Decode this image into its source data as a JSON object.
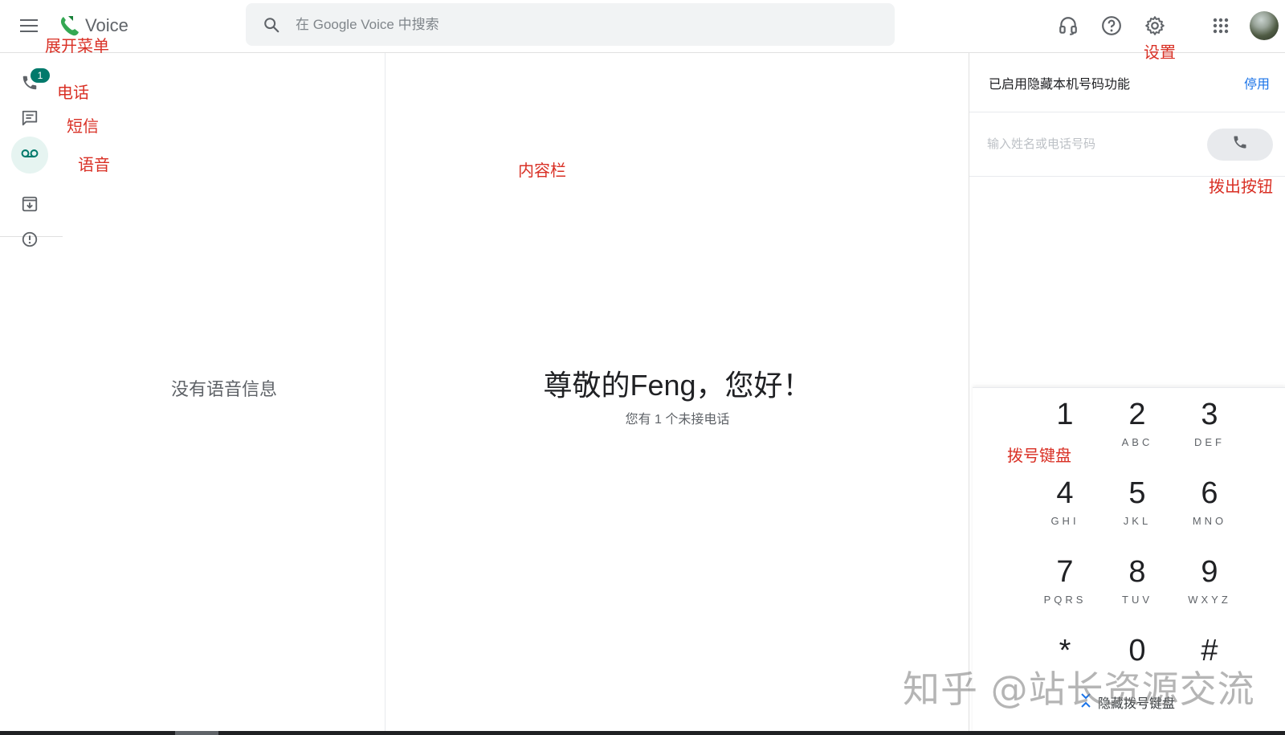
{
  "header": {
    "app_name": "Voice",
    "search": {
      "placeholder": "在 Google Voice 中搜索"
    },
    "icons": [
      "menu-icon",
      "voice-logo-icon",
      "search-icon",
      "headset-icon",
      "help-icon",
      "gear-icon",
      "apps-icon",
      "avatar"
    ]
  },
  "nav": {
    "calls_badge": "1",
    "items": [
      "calls",
      "messages",
      "voicemail",
      "archive",
      "spam"
    ],
    "active": "voicemail"
  },
  "list_panel": {
    "empty_text": "没有语音信息"
  },
  "content": {
    "greeting": "尊敬的Feng，您好！",
    "subtitle": "您有 1 个未接电话"
  },
  "dialer": {
    "caller_id_text": "已启用隐藏本机号码功能",
    "disable_label": "停用",
    "input_placeholder": "输入姓名或电话号码",
    "keys": [
      {
        "digit": "1",
        "letters": ""
      },
      {
        "digit": "2",
        "letters": "ABC"
      },
      {
        "digit": "3",
        "letters": "DEF"
      },
      {
        "digit": "4",
        "letters": "GHI"
      },
      {
        "digit": "5",
        "letters": "JKL"
      },
      {
        "digit": "6",
        "letters": "MNO"
      },
      {
        "digit": "7",
        "letters": "PQRS"
      },
      {
        "digit": "8",
        "letters": "TUV"
      },
      {
        "digit": "9",
        "letters": "WXYZ"
      },
      {
        "digit": "*",
        "letters": ""
      },
      {
        "digit": "0",
        "letters": ""
      },
      {
        "digit": "#",
        "letters": ""
      }
    ],
    "hide_keypad_label": "隐藏拨号键盘"
  },
  "annotations": {
    "menu": "展开菜单",
    "calls": "电话",
    "messages": "短信",
    "voicemail": "语音",
    "content": "内容栏",
    "settings": "设置",
    "call_button": "拨出按钮",
    "keypad": "拨号键盘"
  },
  "watermark": "知乎 @站长资源交流",
  "colors": {
    "accent": "#00796b",
    "link": "#1a73e8",
    "annotation": "#d93025"
  }
}
